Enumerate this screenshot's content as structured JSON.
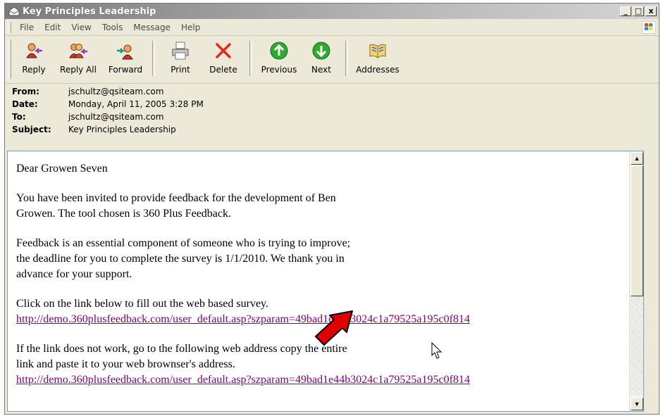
{
  "window": {
    "title": "Key Principles Leadership",
    "controls": {
      "minimize": "_",
      "maximize": "□",
      "close": "x"
    }
  },
  "menu": [
    "File",
    "Edit",
    "View",
    "Tools",
    "Message",
    "Help"
  ],
  "toolbar": {
    "reply": "Reply",
    "reply_all": "Reply All",
    "forward": "Forward",
    "print": "Print",
    "delete": "Delete",
    "previous": "Previous",
    "next": "Next",
    "addresses": "Addresses"
  },
  "headers": {
    "from_label": "From:",
    "from": "jschultz@qsiteam.com",
    "date_label": "Date:",
    "date": "Monday, April 11, 2005 3:28 PM",
    "to_label": "To:",
    "to": "jschultz@qsiteam.com",
    "subject_label": "Subject:",
    "subject": "Key Principles Leadership"
  },
  "message": {
    "greeting": "Dear  Growen Seven",
    "p1_line1": "You have been invited to provide feedback for the development of Ben",
    "p1_line2": "Growen. The tool chosen is 360 Plus Feedback.",
    "p2_line1": "Feedback is an essential component of someone who is trying to improve;",
    "p2_line2": "the deadline for you to complete the survey is 1/1/2010. We thank you in",
    "p2_line3": "advance for your support.",
    "p3_line1": "Click on the link below to fill out the web based survey.",
    "link1": "http://demo.360plusfeedback.com/user_default.asp?szparam=49bad1e44b3024c1a79525a195c0f814",
    "p4_line1": "If the link does not work, go to the following web address copy the entire",
    "p4_line2": "link and paste it to your web brownser's address.",
    "link2": "http://demo.360plusfeedback.com/user_default.asp?szparam=49bad1e44b3024c1a79525a195c0f814"
  },
  "colors": {
    "link": "#800080",
    "arrow": "#e00000",
    "delete_x": "#e8281c",
    "nav_green": "#2eaa2e"
  }
}
